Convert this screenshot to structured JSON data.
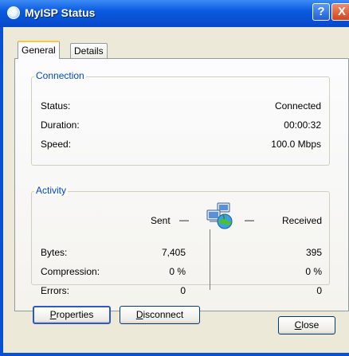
{
  "window": {
    "title": "MyISP Status",
    "help_glyph": "?",
    "close_glyph": "X"
  },
  "tabs": [
    {
      "label": "General",
      "active": true
    },
    {
      "label": "Details",
      "active": false
    }
  ],
  "connection": {
    "group_label": "Connection",
    "rows": [
      {
        "label": "Status:",
        "value": "Connected"
      },
      {
        "label": "Duration:",
        "value": "00:00:32"
      },
      {
        "label": "Speed:",
        "value": "100.0 Mbps"
      }
    ]
  },
  "activity": {
    "group_label": "Activity",
    "sent_label": "Sent",
    "received_label": "Received",
    "sent_dash": "—",
    "received_dash": "—",
    "rows": [
      {
        "label": "Bytes:",
        "sent": "7,405",
        "received": "395"
      },
      {
        "label": "Compression:",
        "sent": "0 %",
        "received": "0 %"
      },
      {
        "label": "Errors:",
        "sent": "0",
        "received": "0"
      }
    ]
  },
  "buttons": {
    "properties": {
      "prefix": "P",
      "rest": "roperties"
    },
    "disconnect": {
      "prefix": "D",
      "rest": "isconnect"
    },
    "close": {
      "prefix": "C",
      "rest": "lose"
    }
  },
  "icons": {
    "network": "network-computers-icon",
    "app": "connection-status-icon"
  },
  "colors": {
    "titlebar": "#0a5be0",
    "group_title": "#0046d5",
    "dialog_bg": "#ece9d8",
    "close_button": "#d3441d"
  }
}
